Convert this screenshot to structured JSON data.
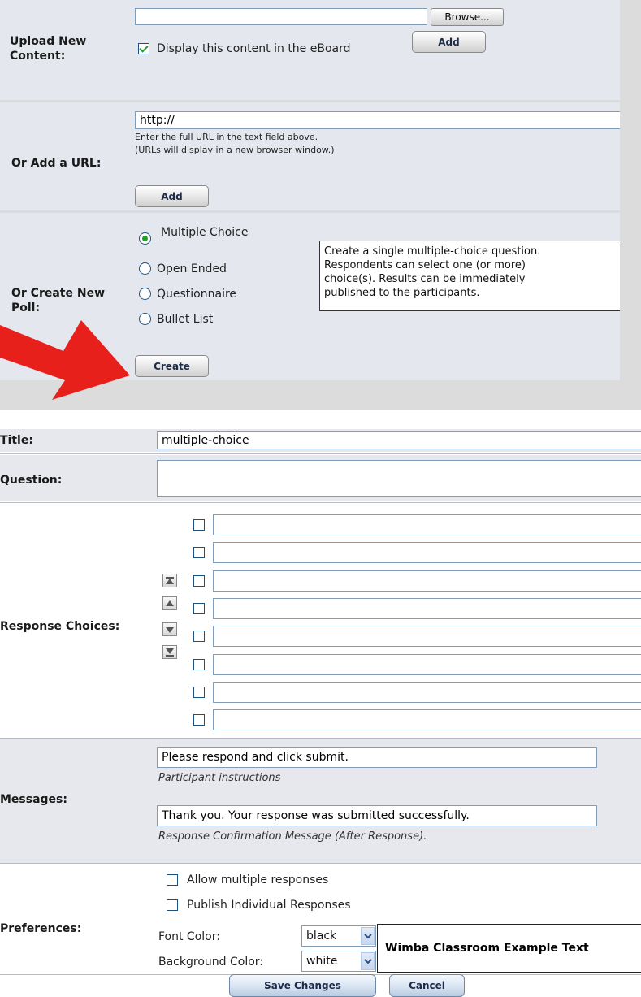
{
  "upload": {
    "label_line1": "Upload New",
    "label_line2": "Content:",
    "file_value": "",
    "browse_label": "Browse...",
    "display_checkbox_label": "Display this content in the eBoard",
    "display_checked": true,
    "add_label": "Add"
  },
  "url": {
    "label": "Or Add a URL:",
    "value": "http://",
    "hint_line1": "Enter the full URL in the text field above.",
    "hint_line2": "(URLs will display in a new browser window.)",
    "add_label": "Add"
  },
  "poll": {
    "label_line1": "Or Create New",
    "label_line2": "Poll:",
    "options": [
      "Multiple Choice",
      "Open Ended",
      "Questionnaire",
      "Bullet List"
    ],
    "selected": "Multiple Choice",
    "description_lines": [
      "Create a single multiple-choice question.",
      "Respondents can select one (or more)",
      "choice(s). Results can be immediately",
      "published to the participants."
    ],
    "create_label": "Create"
  },
  "form": {
    "title_label": "Title:",
    "title_value": "multiple-choice",
    "question_label": "Question:",
    "question_value": "",
    "choices_label": "Response Choices:",
    "choices": [
      "",
      "",
      "",
      "",
      "",
      "",
      "",
      ""
    ],
    "messages_label": "Messages:",
    "instructions_value": "Please respond and click submit.",
    "instructions_caption": "Participant instructions",
    "confirmation_value": "Thank you.  Your response was submitted successfully.",
    "confirmation_caption": "Response Confirmation Message (After Response).",
    "preferences_label": "Preferences:",
    "allow_multiple_label": "Allow multiple responses",
    "publish_individual_label": "Publish Individual Responses",
    "font_color_label": "Font Color:",
    "font_color_value": "black",
    "background_color_label": "Background Color:",
    "background_color_value": "white",
    "example_text": "Wimba Classroom Example Text",
    "save_label": "Save Changes",
    "cancel_label": "Cancel"
  },
  "colors": {
    "arrow": "#e8201c",
    "panel_bg": "#dcdcdc",
    "row_shade": "#e6e8ee"
  }
}
